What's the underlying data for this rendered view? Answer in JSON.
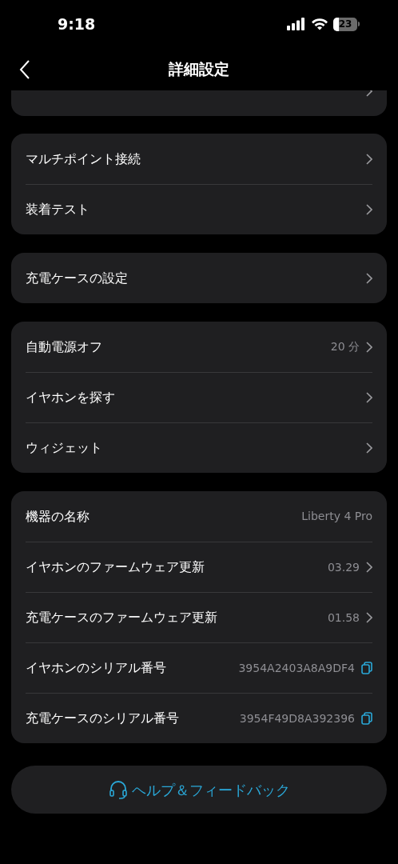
{
  "status_bar": {
    "time": "9:18",
    "battery": "23"
  },
  "nav": {
    "title": "詳細設定"
  },
  "sections": [
    {
      "rows": [
        {
          "label": "マルチポイント接続",
          "kind": "chevron"
        },
        {
          "label": "装着テスト",
          "kind": "chevron"
        }
      ]
    },
    {
      "rows": [
        {
          "label": "充電ケースの設定",
          "kind": "chevron"
        }
      ]
    },
    {
      "rows": [
        {
          "label": "自動電源オフ",
          "value": "20 分",
          "kind": "chevron"
        },
        {
          "label": "イヤホンを探す",
          "kind": "chevron"
        },
        {
          "label": "ウィジェット",
          "kind": "chevron"
        }
      ]
    },
    {
      "rows": [
        {
          "label": "機器の名称",
          "value": "Liberty 4 Pro",
          "kind": "plain"
        },
        {
          "label": "イヤホンのファームウェア更新",
          "value": "03.29",
          "kind": "chevron"
        },
        {
          "label": "充電ケースのファームウェア更新",
          "value": "01.58",
          "kind": "chevron"
        },
        {
          "label": "イヤホンのシリアル番号",
          "value": "3954A2403A8A9DF4",
          "kind": "copy"
        },
        {
          "label": "充電ケースのシリアル番号",
          "value": "3954F49D8A392396",
          "kind": "copy"
        }
      ]
    }
  ],
  "help_button": {
    "label": "ヘルプ＆フィードバック"
  }
}
